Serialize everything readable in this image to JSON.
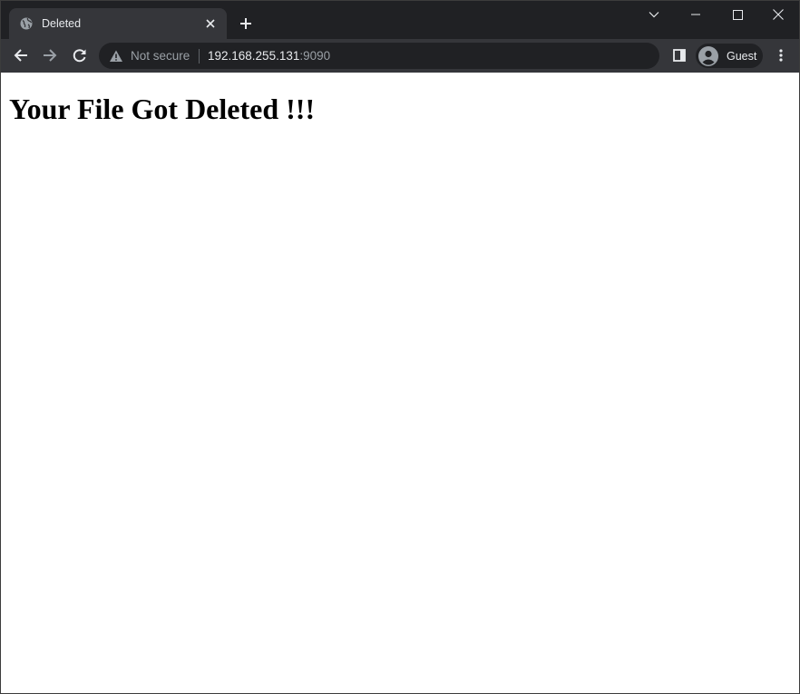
{
  "browser": {
    "tab": {
      "title": "Deleted",
      "favicon": "globe-icon",
      "close_icon": "close-icon"
    },
    "new_tab_icon": "plus-icon",
    "window_controls": [
      "tab-search-icon",
      "minimize-icon",
      "maximize-icon",
      "close-window-icon"
    ],
    "toolbar": {
      "back_icon": "back-arrow-icon",
      "forward_icon": "forward-arrow-icon",
      "reload_icon": "reload-icon",
      "security": {
        "icon": "warning-icon",
        "label": "Not secure"
      },
      "url": {
        "host": "192.168.255.131",
        "port": ":9090"
      },
      "side_panel_icon": "side-panel-icon",
      "profile": {
        "icon": "avatar-icon",
        "label": "Guest"
      },
      "menu_icon": "kebab-menu-icon"
    }
  },
  "page": {
    "heading": "Your File Got Deleted !!!"
  },
  "colors": {
    "tabstrip_bg": "#202124",
    "toolbar_bg": "#35363a",
    "omnibox_bg": "#202124",
    "text_light": "#e8eaed",
    "text_muted": "#9aa0a6",
    "page_bg": "#ffffff"
  }
}
